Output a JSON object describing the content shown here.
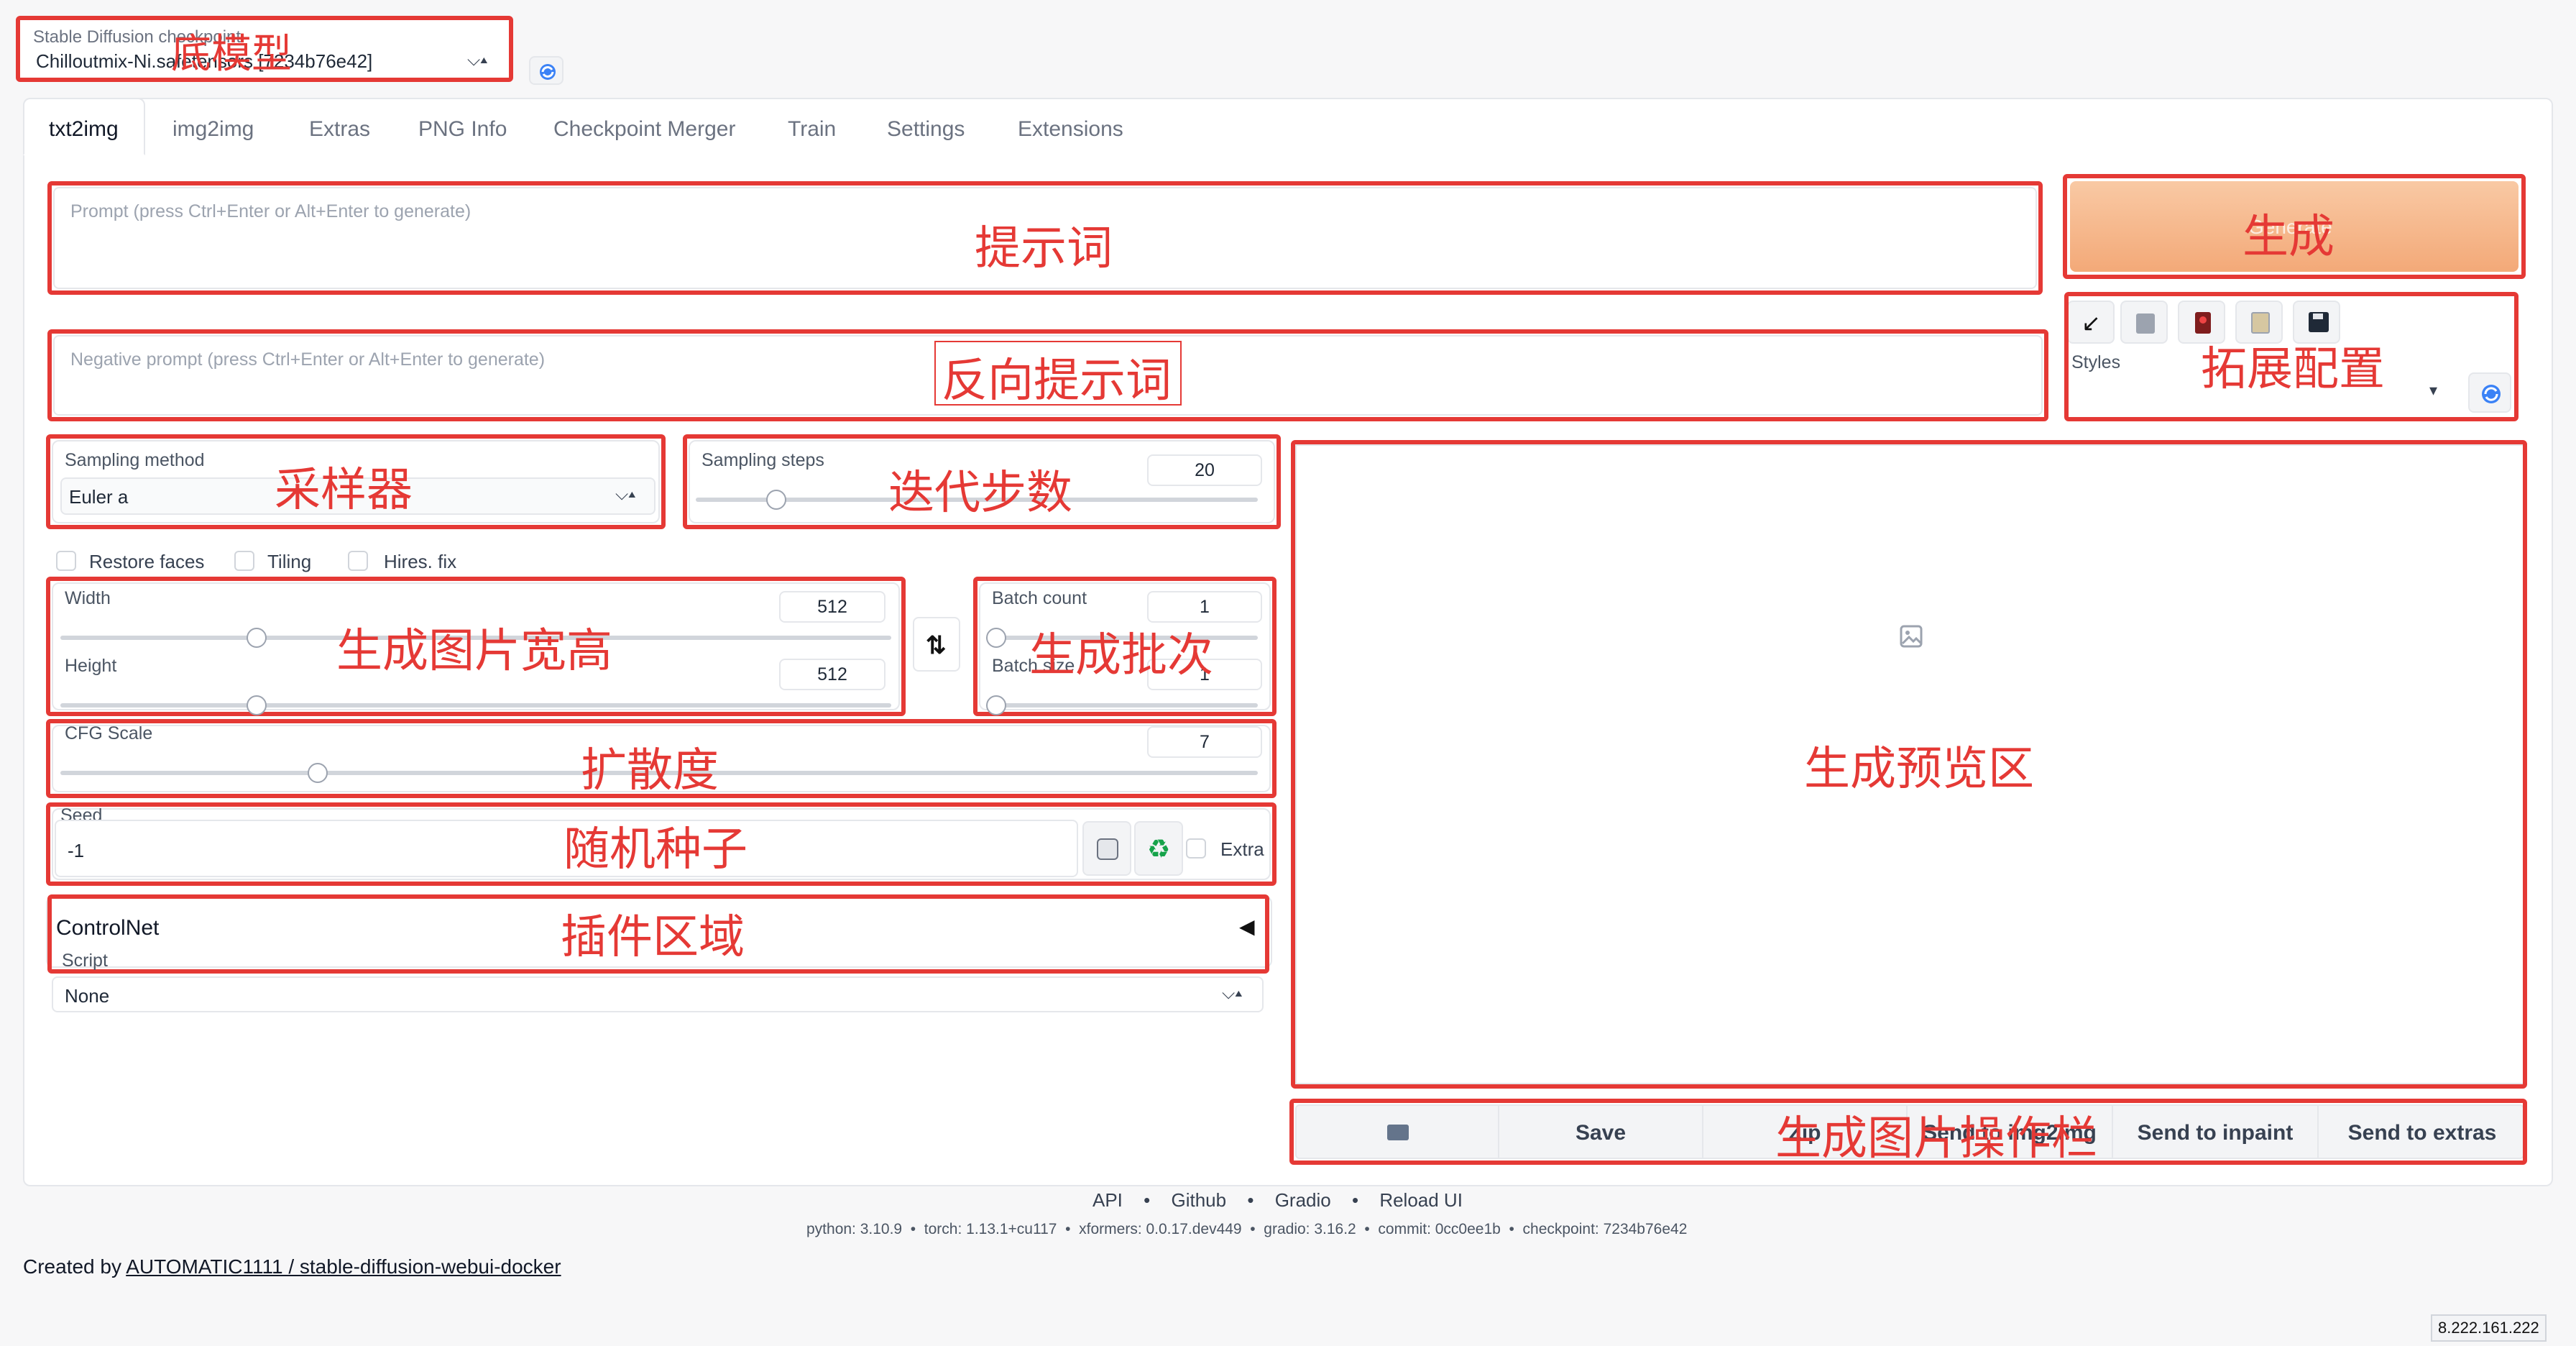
{
  "model": {
    "label": "Stable Diffusion checkpoint",
    "value": "Chilloutmix-Ni.safetensors [7234b76e42]"
  },
  "tabs": [
    "txt2img",
    "img2img",
    "Extras",
    "PNG Info",
    "Checkpoint Merger",
    "Train",
    "Settings",
    "Extensions"
  ],
  "prompt": {
    "placeholder": "Prompt (press Ctrl+Enter or Alt+Enter to generate)"
  },
  "negative_prompt": {
    "placeholder": "Negative prompt (press Ctrl+Enter or Alt+Enter to generate)"
  },
  "generate_label": "Generate",
  "styles_label": "Styles",
  "sampling_method": {
    "label": "Sampling method",
    "value": "Euler a"
  },
  "sampling_steps": {
    "label": "Sampling steps",
    "value": "20",
    "fraction": 0.13
  },
  "checkboxes": [
    "Restore faces",
    "Tiling",
    "Hires. fix"
  ],
  "width": {
    "label": "Width",
    "value": "512",
    "fraction": 0.23
  },
  "height": {
    "label": "Height",
    "value": "512",
    "fraction": 0.23
  },
  "batch_count": {
    "label": "Batch count",
    "value": "1",
    "fraction": 0.0
  },
  "batch_size": {
    "label": "Batch size",
    "value": "1",
    "fraction": 0.0
  },
  "cfg_scale": {
    "label": "CFG Scale",
    "value": "7",
    "fraction": 0.21
  },
  "seed": {
    "label": "Seed",
    "value": "-1",
    "extra_label": "Extra"
  },
  "controlnet_label": "ControlNet",
  "script": {
    "label": "Script",
    "value": "None"
  },
  "output_buttons": [
    "Save",
    "Zip",
    "Send to img2img",
    "Send to inpaint",
    "Send to extras"
  ],
  "footer": {
    "links": [
      "API",
      "Github",
      "Gradio",
      "Reload UI"
    ],
    "versions": "python: 3.10.9  •  torch: 1.13.1+cu117  •  xformers: 0.0.17.dev449  •  gradio: 3.16.2  •  commit: 0cc0ee1b  •  checkpoint: 7234b76e42",
    "created_by_prefix": "Created by ",
    "created_by_link": "AUTOMATIC1111 / stable-diffusion-webui-docker",
    "ip": "8.222.161.222"
  },
  "annotations": {
    "model": "底模型",
    "prompt": "提示词",
    "negative": "反向提示词",
    "generate": "生成",
    "extension": "拓展配置",
    "sampler": "采样器",
    "steps": "迭代步数",
    "size": "生成图片宽高",
    "batch": "生成批次",
    "cfg": "扩散度",
    "seed": "随机种子",
    "plugin": "插件区域",
    "preview": "生成预览区",
    "output": "生成图片操作栏"
  },
  "colors": {
    "annotation": "#e53935",
    "generate_bg": "#f5b98c",
    "accent": "#f97316"
  }
}
